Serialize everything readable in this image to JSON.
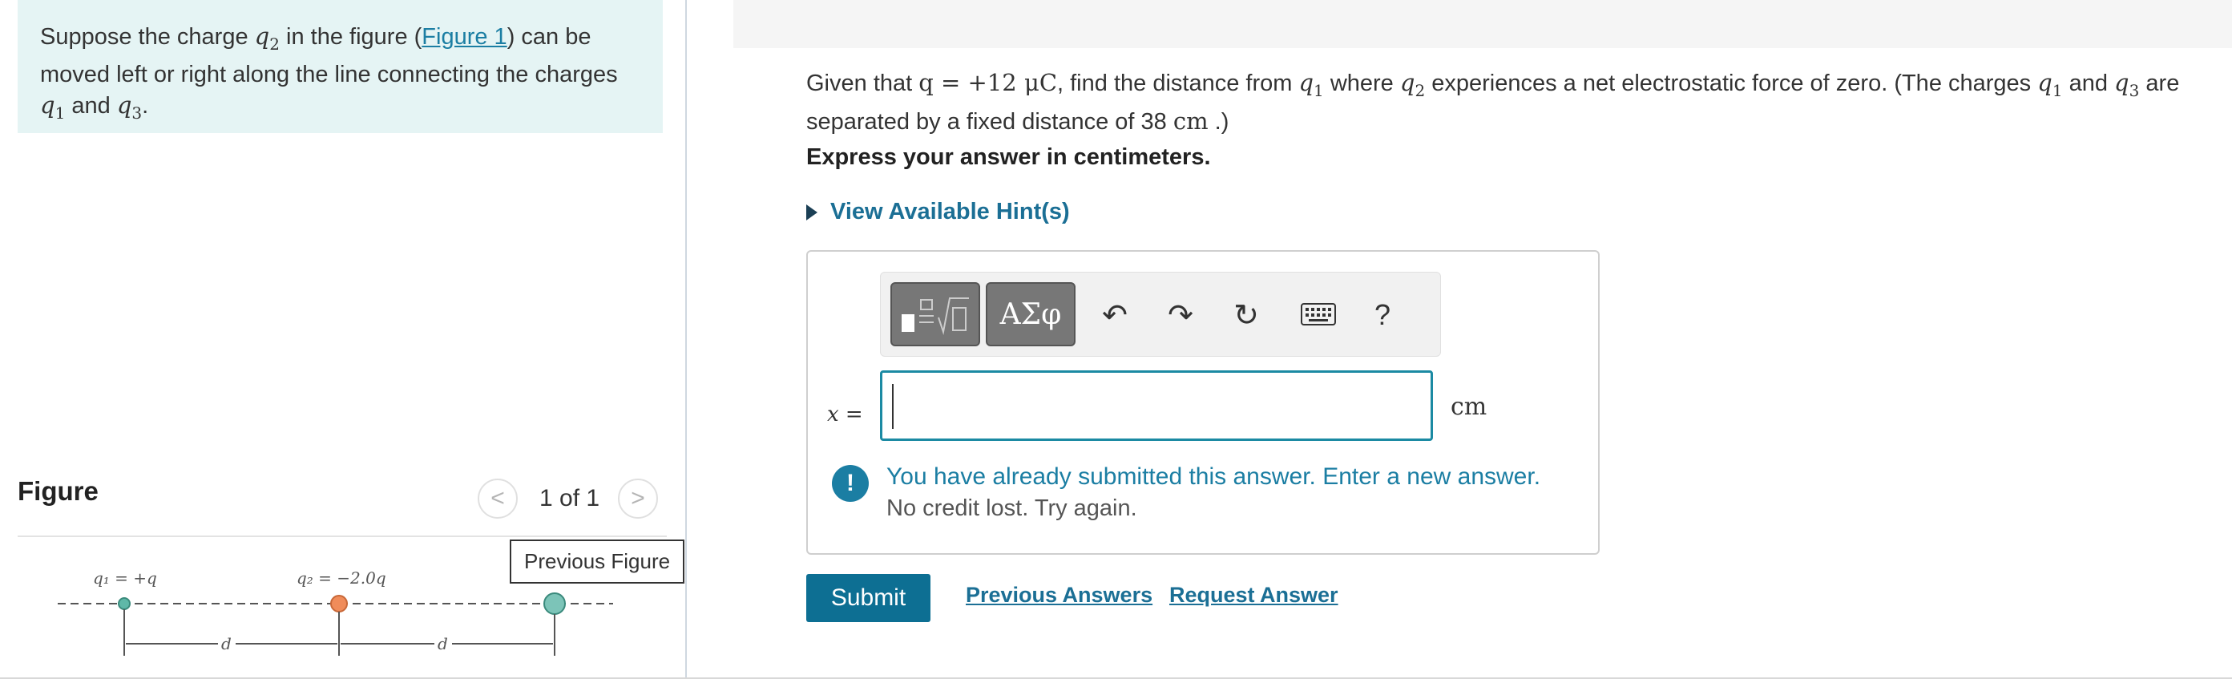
{
  "problem": {
    "line1_pre": "Suppose the charge ",
    "q2_sym": "q",
    "q2_sub": "2",
    "line1_mid": " in the figure (",
    "figure_link": "Figure 1",
    "line1_post": ") can be",
    "line2": "moved left or right along the line connecting the charges",
    "q1_sym": "q",
    "q1_sub": "1",
    "and": " and ",
    "q3_sym": "q",
    "q3_sub": "3",
    "end": "."
  },
  "figure_panel": {
    "title": "Figure",
    "page_count": "1 of 1",
    "prev_symbol": "<",
    "next_symbol": ">",
    "tooltip": "Previous Figure",
    "labels": {
      "q1": "q₁ = +q",
      "q2": "q₂ = −2.0q",
      "d1": "d",
      "d2": "d"
    },
    "colors": {
      "q1": "#5fb8a8",
      "q2": "#f08c5a",
      "q3": "#7cc4b8"
    }
  },
  "question": {
    "part1": "Given that ",
    "q_expr": "q = +12 μC",
    "part2": ", find the distance from ",
    "q1": "q",
    "q1_sub": "1",
    "part3": " where ",
    "q2": "q",
    "q2_sub": "2",
    "part4": " experiences a net electrostatic force of zero. (The charges ",
    "q1b": "q",
    "q1b_sub": "1",
    "part5": " and ",
    "q3": "q",
    "q3_sub": "3",
    "part6": " are separated by a fixed distance of 38 ",
    "unit": "cm",
    "part7": " .)"
  },
  "express": "Express your answer in centimeters.",
  "hints_label": "View Available Hint(s)",
  "answer": {
    "toolbar": {
      "greek": "ΑΣφ",
      "undo": "↶",
      "redo": "↷",
      "reset": "↻",
      "help": "?"
    },
    "var_label": "x =",
    "value": "",
    "unit": "cm",
    "message_line1": "You have already submitted this answer. Enter a new answer.",
    "message_line2": "No credit lost. Try again.",
    "message_icon": "!"
  },
  "actions": {
    "submit": "Submit",
    "previous_answers": "Previous Answers",
    "request_answer": "Request Answer"
  }
}
